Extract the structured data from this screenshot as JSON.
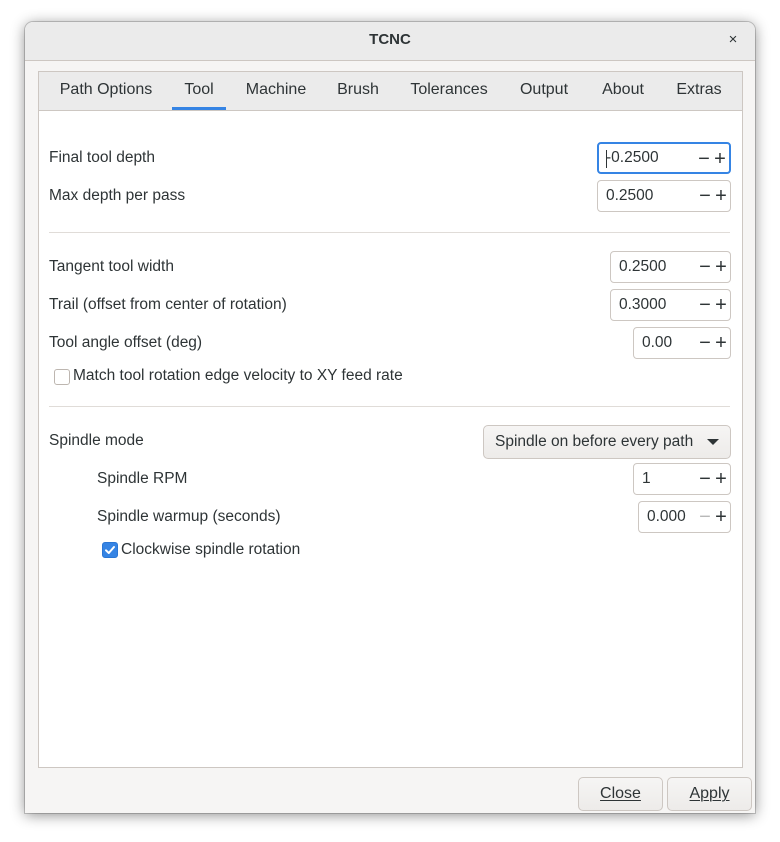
{
  "window": {
    "title": "TCNC",
    "close_glyph": "×"
  },
  "tabs": [
    {
      "label": "Path Options"
    },
    {
      "label": "Tool",
      "active": true
    },
    {
      "label": "Machine"
    },
    {
      "label": "Brush"
    },
    {
      "label": "Tolerances"
    },
    {
      "label": "Output"
    },
    {
      "label": "About"
    },
    {
      "label": "Extras"
    }
  ],
  "tool": {
    "final_depth": {
      "label": "Final tool depth",
      "value": "-0.2500"
    },
    "max_depth": {
      "label": "Max depth per pass",
      "value": "0.2500"
    },
    "tangent_width": {
      "label": "Tangent tool width",
      "value": "0.2500"
    },
    "trail": {
      "label": "Trail (offset from center of rotation)",
      "value": "0.3000"
    },
    "angle_offset": {
      "label": "Tool angle offset (deg)",
      "value": "0.00"
    },
    "match_rotation": {
      "label": "Match tool rotation edge velocity to XY feed rate",
      "checked": false
    }
  },
  "spindle": {
    "mode_label": "Spindle mode",
    "mode_value": "Spindle on before every path",
    "rpm": {
      "label": "Spindle RPM",
      "value": "1"
    },
    "warmup": {
      "label": "Spindle warmup (seconds)",
      "value": "0.000"
    },
    "clockwise": {
      "label": "Clockwise spindle rotation",
      "checked": true
    }
  },
  "spin_glyphs": {
    "minus": "−",
    "plus": "+"
  },
  "buttons": {
    "close": "Close",
    "apply": "Apply"
  },
  "colors": {
    "accent": "#3584e4",
    "text": "#2e3436"
  }
}
